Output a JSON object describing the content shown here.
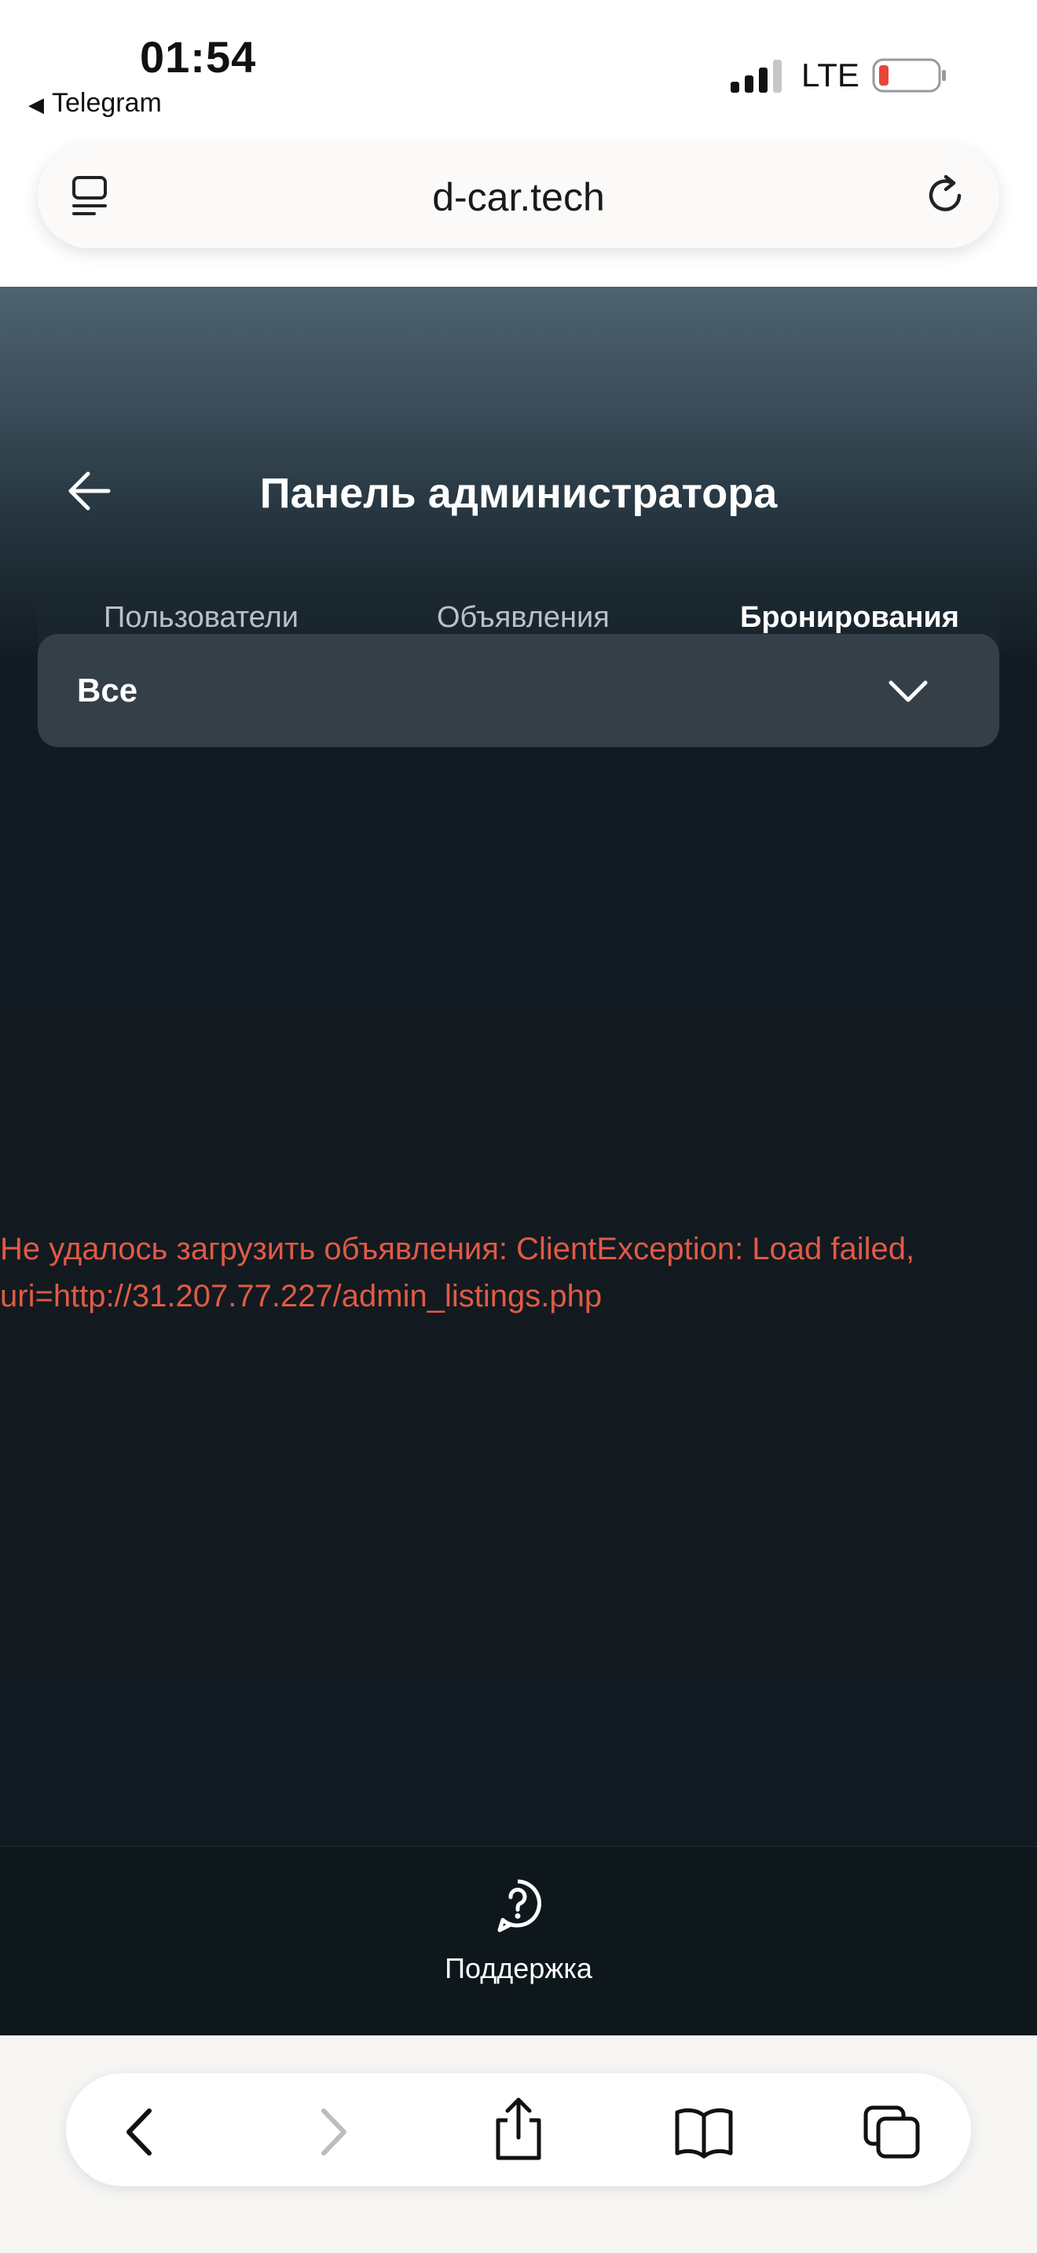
{
  "status_bar": {
    "time": "01:54",
    "back_app": "Telegram",
    "network": "LTE"
  },
  "browser": {
    "url": "d-car.tech"
  },
  "app": {
    "title": "Панель администратора",
    "tabs": [
      {
        "label": "Пользователи",
        "active": false
      },
      {
        "label": "Объявления",
        "active": false
      },
      {
        "label": "Бронирования",
        "active": true
      }
    ],
    "filter": {
      "selected": "Все"
    },
    "error_message": "Не удалось загрузить объявления: ClientException: Load failed, uri=http://31.207.77.227/admin_listings.php",
    "bottom_nav": {
      "support_label": "Поддержка"
    }
  },
  "colors": {
    "error": "#e15a45",
    "background": "#111a20",
    "filter_bg": "#353f47",
    "battery_low": "#e8453c"
  }
}
